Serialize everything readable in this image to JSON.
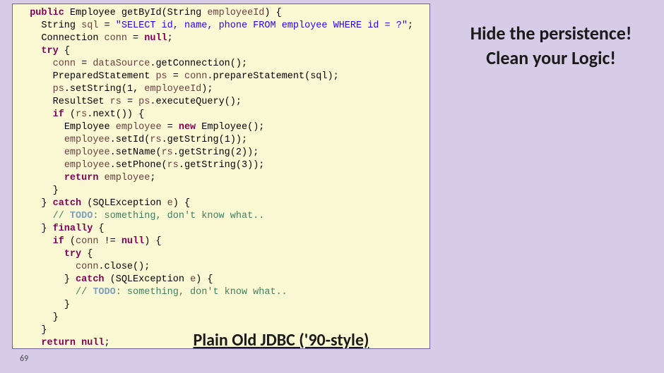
{
  "sidebar": {
    "line1": "Hide the persistence!",
    "line2": "Clean your Logic!"
  },
  "caption": "Plain Old JDBC ('90-style)",
  "slide_number": "69",
  "code": {
    "l1": {
      "kw1": "public",
      "t1": "Employee",
      "m": "getById",
      "p": "(",
      "t2": "String",
      "v": "employeeId",
      "close": ") {"
    },
    "l2": {
      "t": "String",
      "v": "sql",
      "eq": " = ",
      "str": "\"SELECT id, name, phone FROM employee WHERE id = ?\"",
      "end": ";"
    },
    "l3": {
      "t": "Connection",
      "v": "conn",
      "eq": " = ",
      "kw": "null",
      "end": ";"
    },
    "l4": {
      "kw": "try",
      "b": " {"
    },
    "l5": {
      "v": "conn",
      "eq": " = ",
      "obj": "dataSource",
      "dot": ".",
      "call": "getConnection",
      "end": "();"
    },
    "l6": {
      "t": "PreparedStatement",
      "v": "ps",
      "eq": " = ",
      "obj": "conn",
      "dot": ".",
      "call": "prepareStatement",
      "args": "(sql);"
    },
    "l7": {
      "obj": "ps",
      "dot": ".",
      "call": "setString",
      "open": "(",
      "num": "1",
      "comma": ", ",
      "arg": "employeeId",
      "close": ");"
    },
    "l8": {
      "t": "ResultSet",
      "v": "rs",
      "eq": " = ",
      "obj": "ps",
      "dot": ".",
      "call": "executeQuery",
      "end": "();"
    },
    "l9": {
      "kw": "if",
      "open": " (",
      "obj": "rs",
      "dot": ".",
      "call": "next",
      "close": "()) {"
    },
    "l10": {
      "t": "Employee",
      "v": "employee",
      "eq": " = ",
      "kw": "new",
      "sp": " ",
      "ctor": "Employee",
      "end": "();"
    },
    "l11": {
      "obj": "employee",
      "dot": ".",
      "call": "setId",
      "open": "(",
      "r": "rs",
      "dot2": ".",
      "call2": "getString",
      "open2": "(",
      "num": "1",
      "close": "));"
    },
    "l12": {
      "obj": "employee",
      "dot": ".",
      "call": "setName",
      "open": "(",
      "r": "rs",
      "dot2": ".",
      "call2": "getString",
      "open2": "(",
      "num": "2",
      "close": "));"
    },
    "l13": {
      "obj": "employee",
      "dot": ".",
      "call": "setPhone",
      "open": "(",
      "r": "rs",
      "dot2": ".",
      "call2": "getString",
      "open2": "(",
      "num": "3",
      "close": "));"
    },
    "l14": {
      "kw": "return",
      "sp": " ",
      "v": "employee",
      "end": ";"
    },
    "l15": {
      "b": "}"
    },
    "l16": {
      "close": "} ",
      "kw": "catch",
      "open": " (",
      "t": "SQLException",
      "sp": " ",
      "v": "e",
      "b": ") {"
    },
    "l17": {
      "slashes": "// ",
      "todo": "TODO",
      "rest": ": something, don't know what.."
    },
    "l18": {
      "close": "} ",
      "kw": "finally",
      "b": " {"
    },
    "l19": {
      "kw": "if",
      "open": " (",
      "v": "conn",
      "ne": " != ",
      "kw2": "null",
      "b": ") {"
    },
    "l20": {
      "kw": "try",
      "b": " {"
    },
    "l21": {
      "obj": "conn",
      "dot": ".",
      "call": "close",
      "end": "();"
    },
    "l22": {
      "close": "} ",
      "kw": "catch",
      "open": " (",
      "t": "SQLException",
      "sp": " ",
      "v": "e",
      "b": ") {"
    },
    "l23": {
      "slashes": "// ",
      "todo": "TODO",
      "rest": ": something, don't know what.."
    },
    "l24": {
      "b": "}"
    },
    "l25": {
      "b": "}"
    },
    "l26": {
      "b": "}"
    },
    "l27": {
      "kw": "return",
      "sp": " ",
      "kw2": "null",
      "end": ";"
    },
    "l28": {
      "b": "}"
    }
  }
}
